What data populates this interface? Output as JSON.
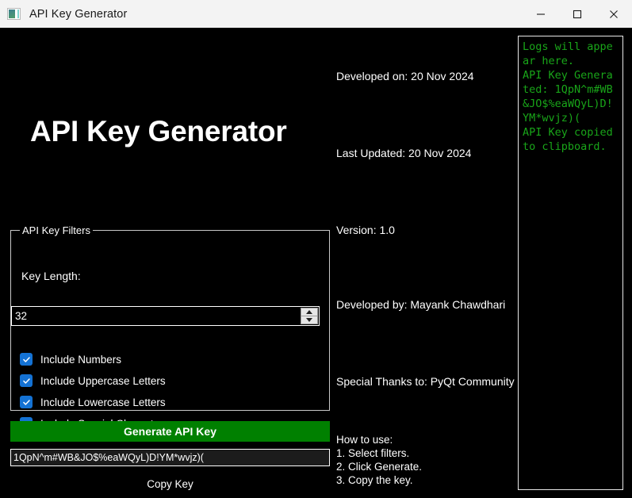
{
  "window": {
    "title": "API Key Generator",
    "icon": "app-icon",
    "controls": {
      "minimize": "minimize-icon",
      "maximize": "maximize-icon",
      "close": "close-icon"
    }
  },
  "left": {
    "heading": "API Key Generator",
    "filters_group": {
      "title": "API Key Filters",
      "key_length_label": "Key Length:",
      "key_length_value": "32",
      "checkboxes": [
        {
          "label": "Include Numbers",
          "checked": true
        },
        {
          "label": "Include Uppercase Letters",
          "checked": true
        },
        {
          "label": "Include Lowercase Letters",
          "checked": true
        },
        {
          "label": "Include Special Characters",
          "checked": true
        }
      ]
    },
    "generate_button": "Generate API Key",
    "generated_key": "1QpN^m#WB&JO$%eaWQyL)D!YM*wvjz)(",
    "copy_button": "Copy Key"
  },
  "info": {
    "developed_on": "Developed on: 20 Nov 2024",
    "last_updated": "Last Updated: 20 Nov 2024",
    "version": "Version: 1.0",
    "developed_by": "Developed by: Mayank Chawdhari",
    "special_thanks": "Special Thanks to: PyQt Community",
    "howto": {
      "heading": "How to use:",
      "step1": "1. Select filters.",
      "step2": "2. Click Generate.",
      "step3": "3. Copy the key."
    }
  },
  "logs": {
    "text": "Logs will appear here.\nAPI Key Generated: 1QpN^m#WB&JO$%eaWQyL)D!YM*wvjz)(\nAPI Key copied to clipboard."
  },
  "colors": {
    "accent_green": "#008000",
    "log_green": "#19a519",
    "checkbox_blue": "#1472d4",
    "background": "#000000",
    "titlebar": "#f3f3f3"
  }
}
